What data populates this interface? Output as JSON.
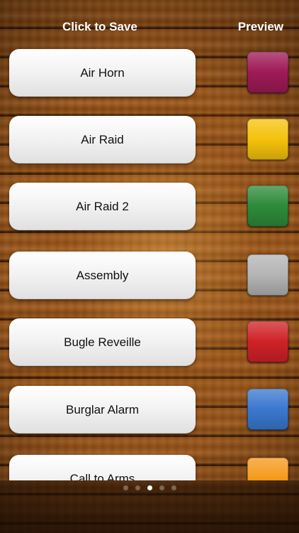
{
  "header": {
    "left_title": "Click to Save",
    "right_title": "Preview"
  },
  "sounds": [
    {
      "label": "Air Horn",
      "color": "#9e1a57"
    },
    {
      "label": "Air Raid",
      "color": "#f5c20c"
    },
    {
      "label": "Air Raid 2",
      "color": "#2e8b3a"
    },
    {
      "label": "Assembly",
      "color": "#b4b4b4"
    },
    {
      "label": "Bugle Reveille",
      "color": "#cf2227"
    },
    {
      "label": "Burglar Alarm",
      "color": "#3a78cf"
    },
    {
      "label": "Call to Arms",
      "color": "#f59a1b"
    }
  ],
  "pager": {
    "count": 5,
    "active_index": 2
  }
}
